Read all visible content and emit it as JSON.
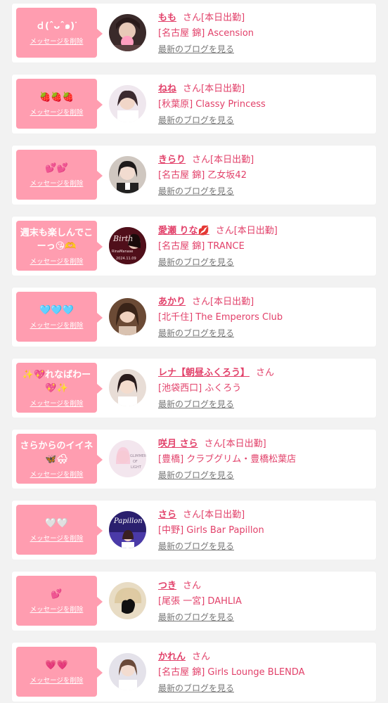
{
  "theme": {
    "accent": "#e2416a",
    "bubble": "#ff9db0",
    "link_gray": "#777777"
  },
  "delete_label": "メッセージを削除",
  "blog_label": "最新のブログを見る",
  "cards": [
    {
      "message": "ｄ(ˆᴗˆ๑)ᐝ",
      "name": "もも",
      "san": "さん",
      "status": "[本日出勤]",
      "area": "[名古屋 錦]",
      "shop": "Ascension"
    },
    {
      "message": "🍓🍓🍓",
      "name": "ねね",
      "san": "さん",
      "status": "[本日出勤]",
      "area": "[秋葉原]",
      "shop": "Classy Princess"
    },
    {
      "message": "💕💕",
      "name": "きらり",
      "san": "さん",
      "status": "[本日出勤]",
      "area": "[名古屋 錦]",
      "shop": "乙女坂42"
    },
    {
      "message": "週末も楽しんでこーっ😘🫶",
      "name": "愛瀬 りな💋",
      "san": "さん",
      "status": "[本日出勤]",
      "area": "[名古屋 錦]",
      "shop": "TRANCE"
    },
    {
      "message": "🩵🩵🩵",
      "name": "あかり",
      "san": "さん",
      "status": "[本日出勤]",
      "area": "[北千住]",
      "shop": "The Emperors Club"
    },
    {
      "message": "✨💖れなばわー💖✨",
      "name": "レナ【朝昼ふくろう】",
      "san": "さん",
      "status": "",
      "area": "[池袋西口]",
      "shop": "ふくろう"
    },
    {
      "message": "さらからのイイネ🦋🌨",
      "name": "咲月 さら",
      "san": "さん",
      "status": "[本日出勤]",
      "area": "[豊橋]",
      "shop": "クラブグリム・豊橋松葉店"
    },
    {
      "message": "🤍🤍",
      "name": "さら",
      "san": "さん",
      "status": "[本日出勤]",
      "area": "[中野]",
      "shop": "Girls Bar Papillon"
    },
    {
      "message": "💕",
      "name": "つき",
      "san": "さん",
      "status": "",
      "area": "[尾張 一宮]",
      "shop": "DAHLIA"
    },
    {
      "message": "💗💗",
      "name": "かれん",
      "san": "さん",
      "status": "",
      "area": "[名古屋 錦]",
      "shop": "Girls Lounge BLENDA"
    }
  ]
}
